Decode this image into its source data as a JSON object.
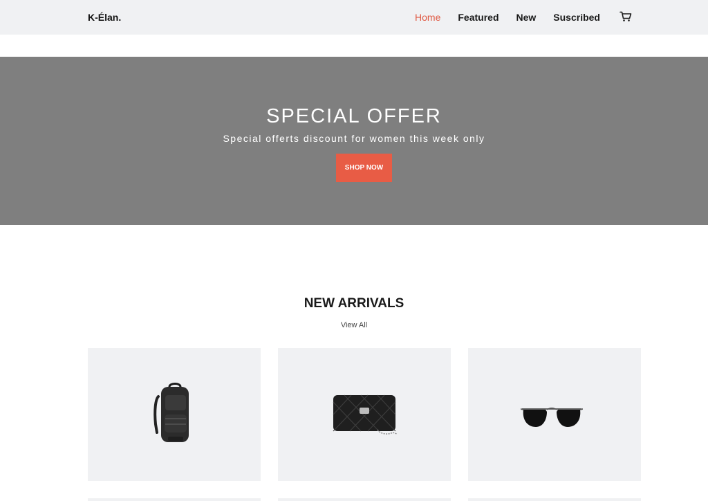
{
  "brand": "K-Élan.",
  "nav": {
    "links": [
      {
        "label": "Home",
        "active": true
      },
      {
        "label": "Featured",
        "active": false
      },
      {
        "label": "New",
        "active": false
      },
      {
        "label": "Suscribed",
        "active": false
      }
    ],
    "cart_icon": "cart-icon"
  },
  "hero": {
    "title": "SPECIAL OFFER",
    "subtitle": "Special offerts discount for women this week only",
    "button_label": "SHOP NOW",
    "background": "#7f7f7f",
    "accent": "#e85c45"
  },
  "arrivals": {
    "title": "NEW ARRIVALS",
    "view_all": "View All",
    "products": [
      {
        "icon": "backpack-icon"
      },
      {
        "icon": "handbag-icon"
      },
      {
        "icon": "sunglasses-icon"
      }
    ]
  },
  "colors": {
    "nav_bg": "#f0f1f3",
    "active_link": "#e05a44",
    "card_bg": "#f0f1f3"
  }
}
